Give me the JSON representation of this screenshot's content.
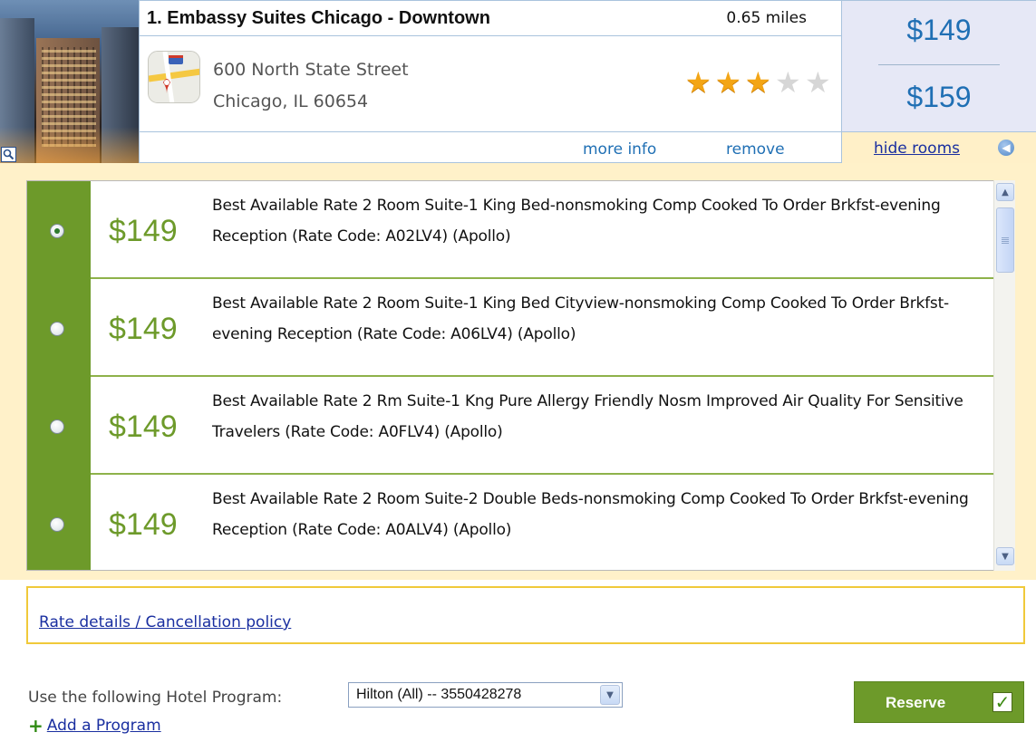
{
  "hotel": {
    "name": "1. Embassy Suites Chicago - Downtown",
    "distance": "0.65 miles",
    "address_line1": "600 North State Street",
    "address_line2": "Chicago, IL 60654",
    "rating": 3,
    "rating_max": 5,
    "more_info": "more info",
    "remove": "remove"
  },
  "prices": {
    "low": "$149",
    "high": "$159",
    "hide_rooms": "hide rooms"
  },
  "rooms": [
    {
      "price": "$149",
      "selected": true,
      "description": "Best Available Rate 2 Room Suite-1 King Bed-nonsmoking Comp Cooked To Order Brkfst-evening Reception (Rate Code: A02LV4)  (Apollo)"
    },
    {
      "price": "$149",
      "selected": false,
      "description": "Best Available Rate 2 Room Suite-1 King Bed Cityview-nonsmoking Comp Cooked To Order Brkfst-evening Reception (Rate Code: A06LV4)  (Apollo)"
    },
    {
      "price": "$149",
      "selected": false,
      "description": "Best Available Rate 2 Rm Suite-1 Kng Pure Allergy Friendly Nosm Improved Air Quality For Sensitive Travelers (Rate Code: A0FLV4)  (Apollo)"
    },
    {
      "price": "$149",
      "selected": false,
      "description": "Best Available Rate 2 Room Suite-2 Double Beds-nonsmoking Comp Cooked To Order Brkfst-evening Reception (Rate Code: A0ALV4)  (Apollo)"
    }
  ],
  "rate_details_link": "Rate details / Cancellation policy",
  "program": {
    "label": "Use the following Hotel Program:",
    "selected": "Hilton (All) -- 3550428278",
    "add_link": "Add a Program"
  },
  "reserve_label": "Reserve",
  "colors": {
    "accent_green": "#6d9a2a",
    "link_blue": "#1f6fb4",
    "highlight_yellow": "#fff1c9"
  },
  "icons": {
    "zoom": "magnifier-icon",
    "map": "map-icon",
    "hide_rooms": "chevron-left-circle-icon",
    "scroll_up": "chevron-up-icon",
    "scroll_down": "chevron-down-icon",
    "select_dropdown": "chevron-down-icon",
    "add": "plus-icon",
    "reserve": "checkmark-icon"
  }
}
